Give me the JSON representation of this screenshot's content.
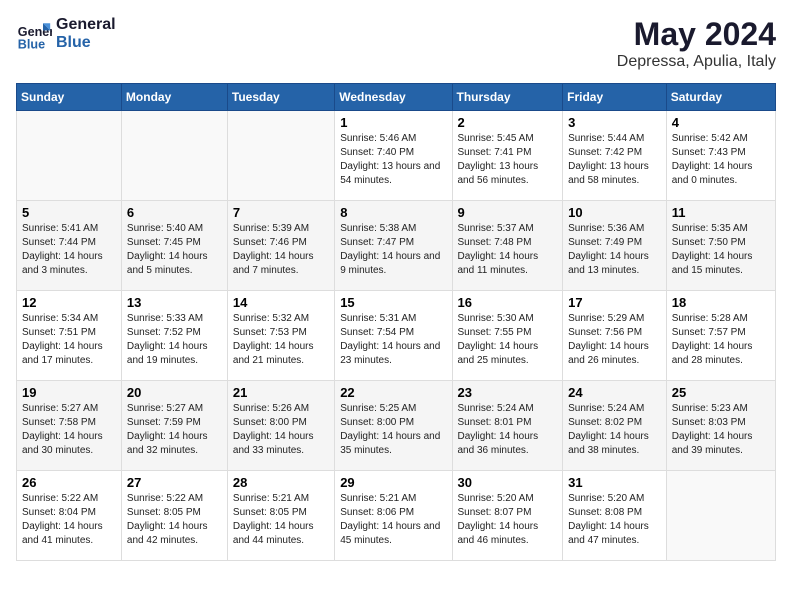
{
  "header": {
    "logo_line1": "General",
    "logo_line2": "Blue",
    "title": "May 2024",
    "subtitle": "Depressa, Apulia, Italy"
  },
  "days_of_week": [
    "Sunday",
    "Monday",
    "Tuesday",
    "Wednesday",
    "Thursday",
    "Friday",
    "Saturday"
  ],
  "weeks": [
    [
      {
        "day": "",
        "info": ""
      },
      {
        "day": "",
        "info": ""
      },
      {
        "day": "",
        "info": ""
      },
      {
        "day": "1",
        "info": "Sunrise: 5:46 AM\nSunset: 7:40 PM\nDaylight: 13 hours and 54 minutes."
      },
      {
        "day": "2",
        "info": "Sunrise: 5:45 AM\nSunset: 7:41 PM\nDaylight: 13 hours and 56 minutes."
      },
      {
        "day": "3",
        "info": "Sunrise: 5:44 AM\nSunset: 7:42 PM\nDaylight: 13 hours and 58 minutes."
      },
      {
        "day": "4",
        "info": "Sunrise: 5:42 AM\nSunset: 7:43 PM\nDaylight: 14 hours and 0 minutes."
      }
    ],
    [
      {
        "day": "5",
        "info": "Sunrise: 5:41 AM\nSunset: 7:44 PM\nDaylight: 14 hours and 3 minutes."
      },
      {
        "day": "6",
        "info": "Sunrise: 5:40 AM\nSunset: 7:45 PM\nDaylight: 14 hours and 5 minutes."
      },
      {
        "day": "7",
        "info": "Sunrise: 5:39 AM\nSunset: 7:46 PM\nDaylight: 14 hours and 7 minutes."
      },
      {
        "day": "8",
        "info": "Sunrise: 5:38 AM\nSunset: 7:47 PM\nDaylight: 14 hours and 9 minutes."
      },
      {
        "day": "9",
        "info": "Sunrise: 5:37 AM\nSunset: 7:48 PM\nDaylight: 14 hours and 11 minutes."
      },
      {
        "day": "10",
        "info": "Sunrise: 5:36 AM\nSunset: 7:49 PM\nDaylight: 14 hours and 13 minutes."
      },
      {
        "day": "11",
        "info": "Sunrise: 5:35 AM\nSunset: 7:50 PM\nDaylight: 14 hours and 15 minutes."
      }
    ],
    [
      {
        "day": "12",
        "info": "Sunrise: 5:34 AM\nSunset: 7:51 PM\nDaylight: 14 hours and 17 minutes."
      },
      {
        "day": "13",
        "info": "Sunrise: 5:33 AM\nSunset: 7:52 PM\nDaylight: 14 hours and 19 minutes."
      },
      {
        "day": "14",
        "info": "Sunrise: 5:32 AM\nSunset: 7:53 PM\nDaylight: 14 hours and 21 minutes."
      },
      {
        "day": "15",
        "info": "Sunrise: 5:31 AM\nSunset: 7:54 PM\nDaylight: 14 hours and 23 minutes."
      },
      {
        "day": "16",
        "info": "Sunrise: 5:30 AM\nSunset: 7:55 PM\nDaylight: 14 hours and 25 minutes."
      },
      {
        "day": "17",
        "info": "Sunrise: 5:29 AM\nSunset: 7:56 PM\nDaylight: 14 hours and 26 minutes."
      },
      {
        "day": "18",
        "info": "Sunrise: 5:28 AM\nSunset: 7:57 PM\nDaylight: 14 hours and 28 minutes."
      }
    ],
    [
      {
        "day": "19",
        "info": "Sunrise: 5:27 AM\nSunset: 7:58 PM\nDaylight: 14 hours and 30 minutes."
      },
      {
        "day": "20",
        "info": "Sunrise: 5:27 AM\nSunset: 7:59 PM\nDaylight: 14 hours and 32 minutes."
      },
      {
        "day": "21",
        "info": "Sunrise: 5:26 AM\nSunset: 8:00 PM\nDaylight: 14 hours and 33 minutes."
      },
      {
        "day": "22",
        "info": "Sunrise: 5:25 AM\nSunset: 8:00 PM\nDaylight: 14 hours and 35 minutes."
      },
      {
        "day": "23",
        "info": "Sunrise: 5:24 AM\nSunset: 8:01 PM\nDaylight: 14 hours and 36 minutes."
      },
      {
        "day": "24",
        "info": "Sunrise: 5:24 AM\nSunset: 8:02 PM\nDaylight: 14 hours and 38 minutes."
      },
      {
        "day": "25",
        "info": "Sunrise: 5:23 AM\nSunset: 8:03 PM\nDaylight: 14 hours and 39 minutes."
      }
    ],
    [
      {
        "day": "26",
        "info": "Sunrise: 5:22 AM\nSunset: 8:04 PM\nDaylight: 14 hours and 41 minutes."
      },
      {
        "day": "27",
        "info": "Sunrise: 5:22 AM\nSunset: 8:05 PM\nDaylight: 14 hours and 42 minutes."
      },
      {
        "day": "28",
        "info": "Sunrise: 5:21 AM\nSunset: 8:05 PM\nDaylight: 14 hours and 44 minutes."
      },
      {
        "day": "29",
        "info": "Sunrise: 5:21 AM\nSunset: 8:06 PM\nDaylight: 14 hours and 45 minutes."
      },
      {
        "day": "30",
        "info": "Sunrise: 5:20 AM\nSunset: 8:07 PM\nDaylight: 14 hours and 46 minutes."
      },
      {
        "day": "31",
        "info": "Sunrise: 5:20 AM\nSunset: 8:08 PM\nDaylight: 14 hours and 47 minutes."
      },
      {
        "day": "",
        "info": ""
      }
    ]
  ]
}
